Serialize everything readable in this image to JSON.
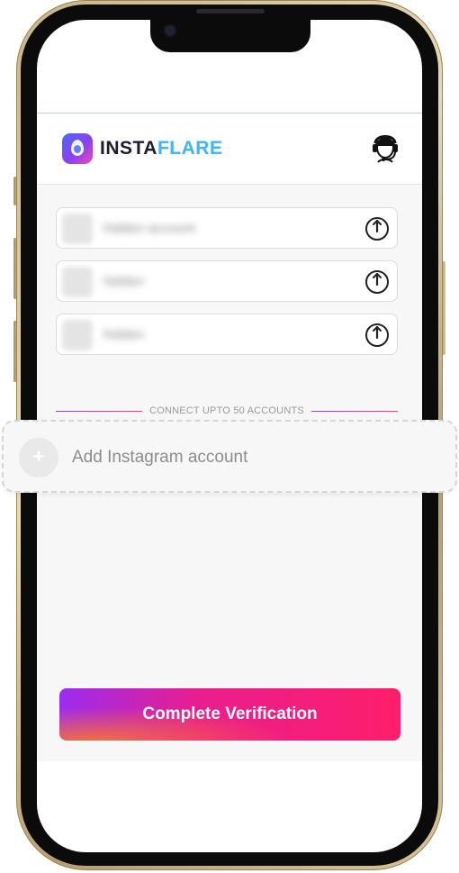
{
  "header": {
    "brand_part1": "INSTA",
    "brand_part2": "FLARE",
    "logo_icon": "flame-drop-logo-icon",
    "support_icon": "headset-support-icon"
  },
  "accounts": [
    {
      "name": "hidden account",
      "action_icon": "power-icon"
    },
    {
      "name": "hidden",
      "action_icon": "power-icon"
    },
    {
      "name": "hidden",
      "action_icon": "power-icon"
    }
  ],
  "divider": {
    "text": "CONNECT UPTO 50 ACCOUNTS"
  },
  "add_account": {
    "label": "Add Instagram account",
    "icon": "plus-icon",
    "icon_glyph": "+"
  },
  "cta": {
    "label": "Complete Verification"
  },
  "colors": {
    "accent_purple": "#9b2cf0",
    "accent_pink": "#ff1e6a",
    "brand_blue": "#45b6f0",
    "background": "#f7f7f7"
  }
}
